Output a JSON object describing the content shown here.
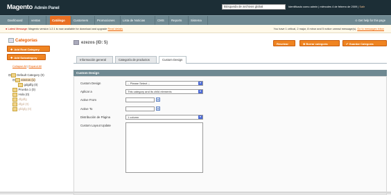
{
  "header": {
    "logo_main": "Magento",
    "logo_sub": "Admin Panel",
    "search_value": "Búsqueda de archivos global",
    "info_text": "Identificado como admin | miércoles 4 de febrero de 2009 |",
    "logout_label": "Salir"
  },
  "nav": {
    "items": [
      "Dashboard",
      "ventas",
      "Catálogo",
      "Customers",
      "Promociones",
      "Lista de Noticias",
      "CMS",
      "Reports",
      "Sistema"
    ],
    "help_label": "Get help for this page"
  },
  "notice": {
    "latest_label": "Latest Message:",
    "message": "Magento version 1.2.1 is now available for download and upgrade",
    "message_link": "Read details",
    "right_text": "You have 1 crítical, 2 major, 8 minor and 5 notice unread message(s).",
    "right_link": "Go to messages inbox"
  },
  "sidebar": {
    "title": "Categorías",
    "add_root_label": "Add Root Category",
    "add_sub_label": "Add Subcategory",
    "collapse_all": "Collapse All",
    "expand_all": "Expand All",
    "tree": [
      {
        "label": "Default Category (0)",
        "level": 0,
        "state": "normal"
      },
      {
        "label": "ezezos (1)",
        "level": 1,
        "state": "selected"
      },
      {
        "label": "gdgdfg (0)",
        "level": 2,
        "state": "normal"
      },
      {
        "label": "Prueba 1 (0)",
        "level": 1,
        "state": "normal"
      },
      {
        "label": "Hola (0)",
        "level": 1,
        "state": "normal"
      },
      {
        "label": "dfgdfg",
        "level": 1,
        "state": "dim"
      },
      {
        "label": "dfgd (0)",
        "level": 1,
        "state": "dim"
      },
      {
        "label": "gfdgfg (0)",
        "level": 1,
        "state": "dim"
      }
    ]
  },
  "content": {
    "title": "ezezos (ID: 5)",
    "buttons": {
      "reset": "Resetear",
      "delete": "Borrar categoría",
      "save": "Guardar Categoría"
    },
    "tabs": [
      "Información general",
      "Categoría de productos",
      "Custom Design"
    ],
    "fieldset_title": "Custom Design",
    "fields": {
      "custom_design_label": "Custom Design",
      "custom_design_value": "-- Please Select --",
      "apply_to_label": "Aplicar a",
      "apply_to_value": "This category and its child elements",
      "active_from_label": "Active From",
      "active_to_label": "Active To",
      "layout_label": "Distribución de Página",
      "layout_value": "1 column",
      "custom_layout_label": "Custom Layout Update"
    }
  },
  "colors": {
    "header_bg": "#1c2e36",
    "nav_bg": "#6f8992",
    "accent_orange": "#ef8421",
    "active_tab": "#e86f23"
  }
}
